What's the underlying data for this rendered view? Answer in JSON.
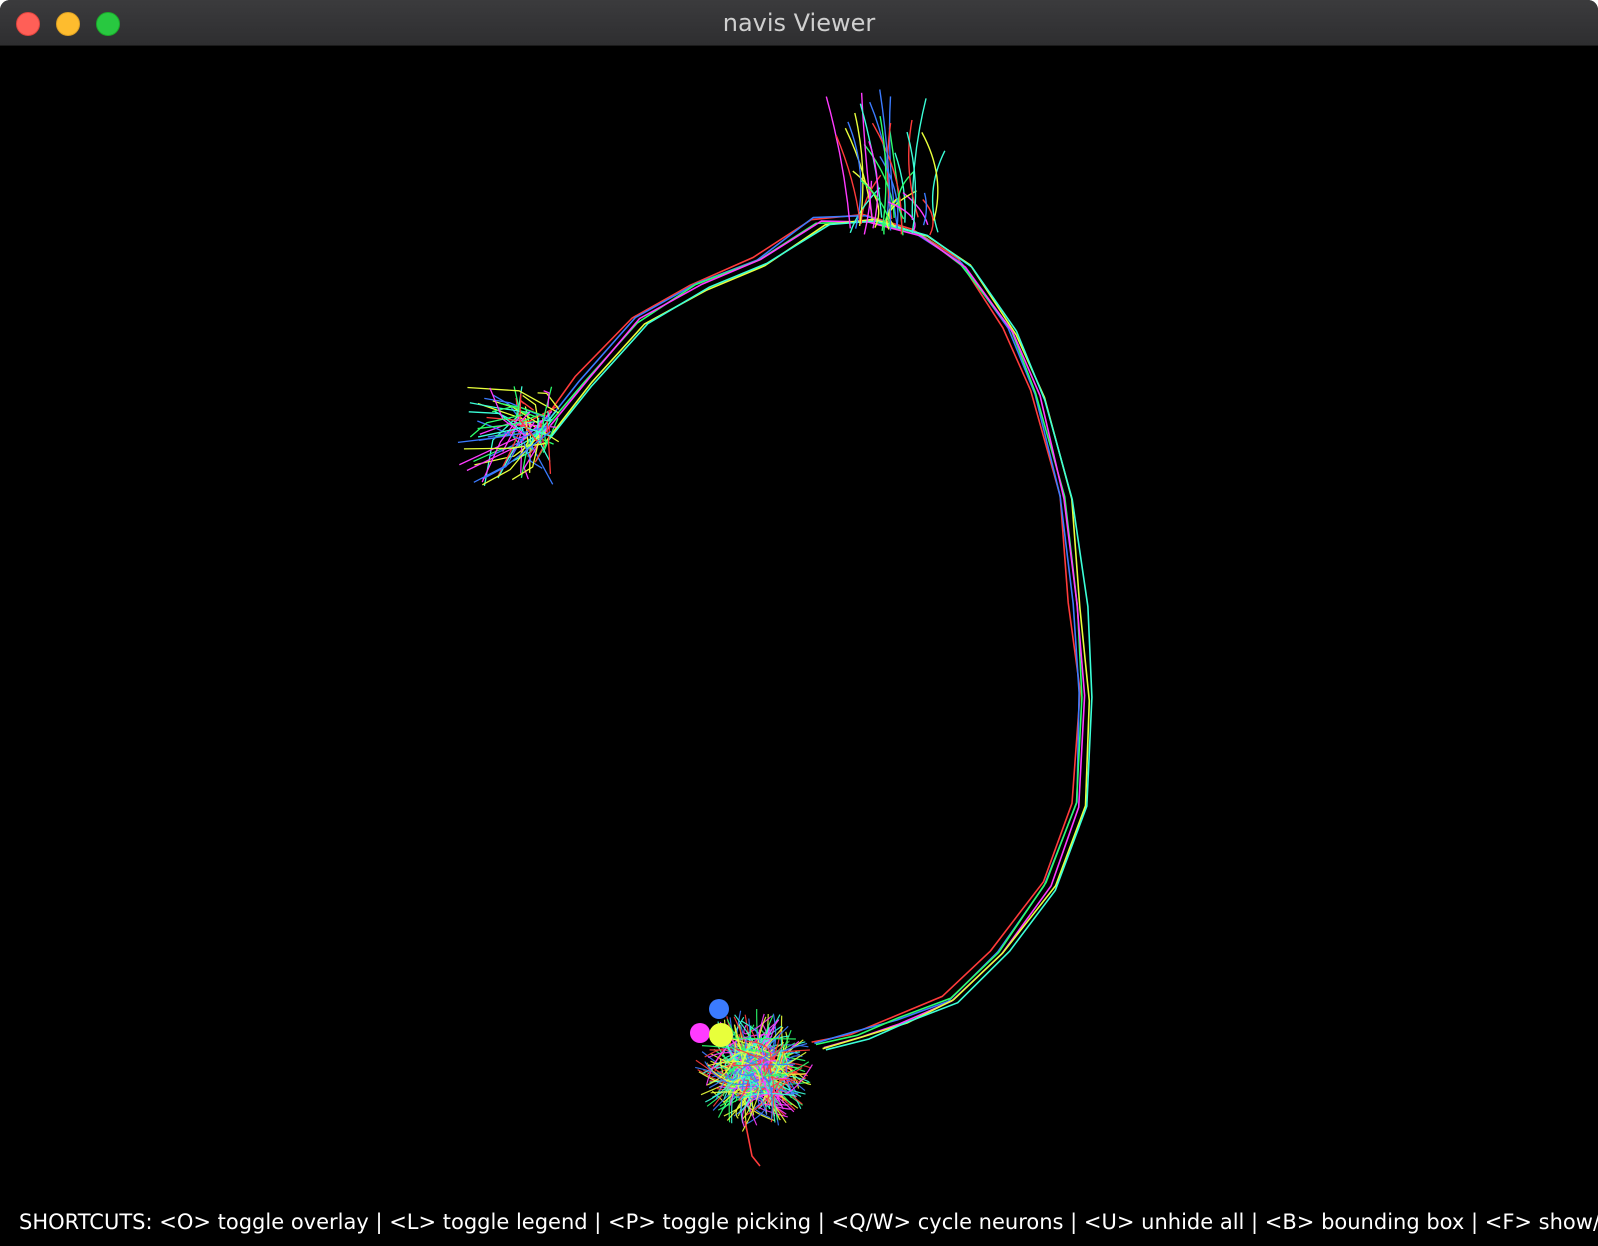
{
  "window": {
    "title": "navis Viewer",
    "traffic_lights": {
      "close": "#ff5f57",
      "minimize": "#febc2e",
      "maximize": "#28c840"
    }
  },
  "viewport": {
    "background": "#000000",
    "neuron_colors": [
      "#ff3b3b",
      "#3b7bff",
      "#2bff6a",
      "#ff3bff",
      "#e8ff3b",
      "#3bffd8"
    ]
  },
  "footer": {
    "shortcuts_text": "SHORTCUTS: <O> toggle overlay | <L> toggle legend | <P> toggle picking | <Q/W> cycle neurons | <U> unhide all | <B> bounding box | <F> show/hide FPS | <"
  }
}
